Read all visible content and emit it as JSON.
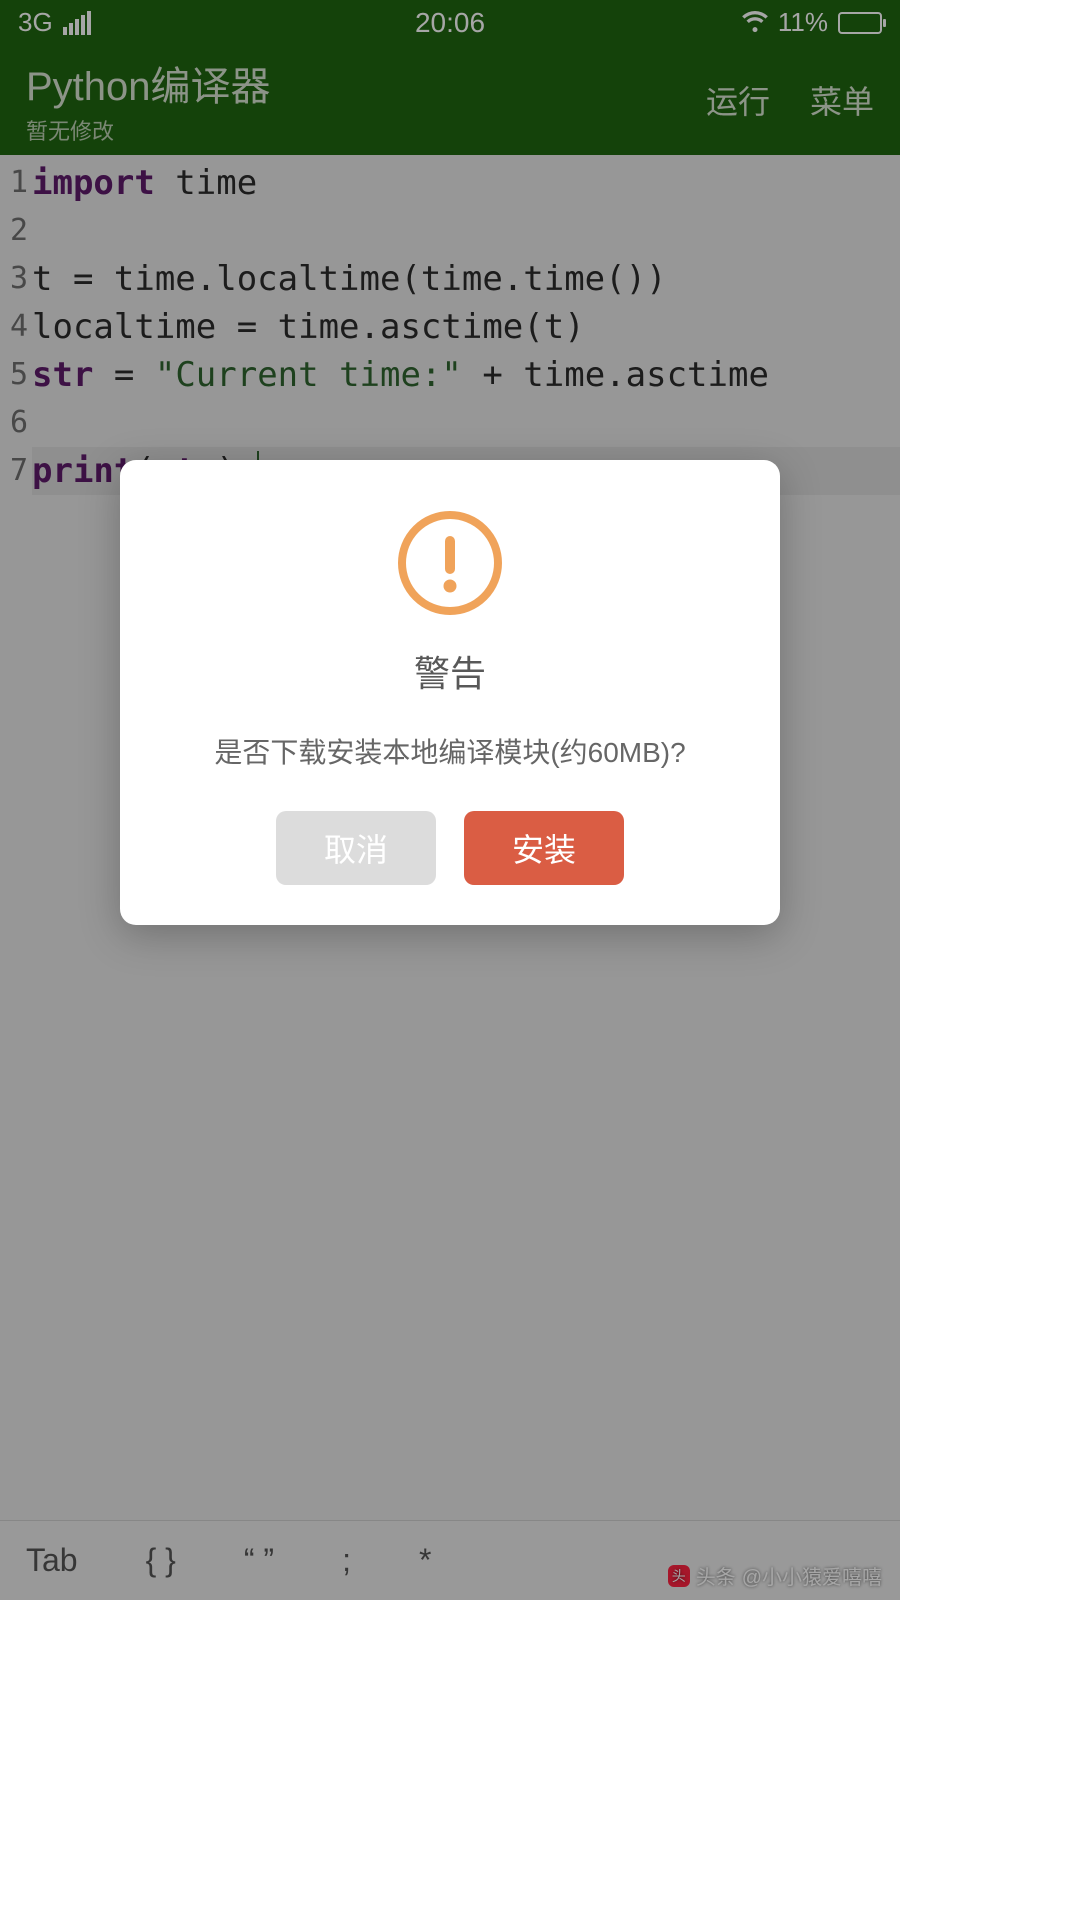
{
  "status": {
    "network": "3G",
    "time": "20:06",
    "battery_pct": "11%"
  },
  "header": {
    "title": "Python编译器",
    "subtitle": "暂无修改",
    "run": "运行",
    "menu": "菜单"
  },
  "code": {
    "lines": [
      "1",
      "2",
      "3",
      "4",
      "5",
      "6",
      "7"
    ],
    "l1_kw": "import",
    "l1_rest": " time",
    "l3": "t = time.localtime(time.time())",
    "l4": "localtime = time.asctime(t)",
    "l5_a": "str",
    "l5_b": " = ",
    "l5_str": "\"Current time:\"",
    "l5_c": " + time.asctime",
    "l7_a": "print",
    "l7_b": "(",
    "l7_c": "str",
    "l7_d": ");"
  },
  "dialog": {
    "title": "警告",
    "message": "是否下载安装本地编译模块(约60MB)?",
    "cancel": "取消",
    "install": "安装"
  },
  "bottom": {
    "tab": "Tab",
    "braces": "{ }",
    "quotes": "“ ”",
    "semicolon": ";",
    "star": "*"
  },
  "watermark": {
    "label": "头条",
    "handle": "@小小猿爱嘻嘻"
  }
}
